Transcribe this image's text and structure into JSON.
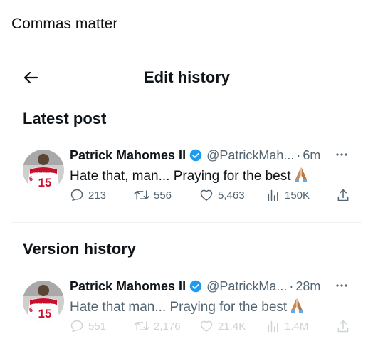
{
  "caption": "Commas matter",
  "header": {
    "title": "Edit history",
    "back_icon": "arrow-left-icon"
  },
  "sections": {
    "latest_title": "Latest post",
    "version_title": "Version history"
  },
  "posts": [
    {
      "name": "Patrick Mahomes II",
      "handle": "@PatrickMah...",
      "separator": "·",
      "time": "6m",
      "text": "Hate that, man... Praying for the best",
      "stats": {
        "replies": "213",
        "reposts": "556",
        "likes": "5,463",
        "views": "150K"
      }
    },
    {
      "name": "Patrick Mahomes II",
      "handle": "@PatrickMa...",
      "separator": "·",
      "time": "28m",
      "text": "Hate that man... Praying for the best",
      "stats": {
        "replies": "551",
        "reposts": "2,176",
        "likes": "21.4K",
        "views": "1.4M"
      }
    }
  ],
  "colors": {
    "verified": "#1d9bf0",
    "text": "#0f1419",
    "secondary": "#536471",
    "jersey": "#c8102e"
  }
}
